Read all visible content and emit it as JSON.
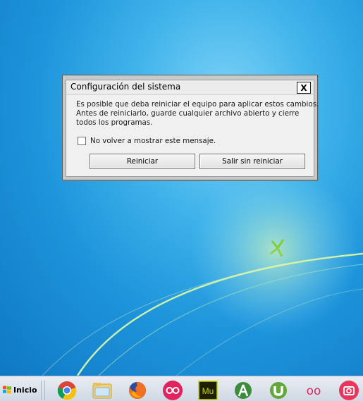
{
  "dialog": {
    "title": "Configuración del sistema",
    "close_glyph": "X",
    "message_lines": [
      "Es posible que deba reiniciar el equipo para aplicar estos cambios.",
      "Antes de reiniciarlo, guarde cualquier archivo abierto y cierre",
      "todos los programas."
    ],
    "checkbox_label": "No volver a mostrar este mensaje.",
    "checkbox_checked": false,
    "restart_button": "Reiniciar",
    "exit_button": "Salir sin reiniciar"
  },
  "taskbar": {
    "start_label": "Inicio",
    "apps": [
      {
        "icon": "chrome-icon"
      },
      {
        "icon": "file-explorer-icon"
      },
      {
        "icon": "firefox-icon"
      },
      {
        "icon": "flickr-icon"
      },
      {
        "icon": "adobe-muse-icon",
        "text": "Mu"
      },
      {
        "icon": "android-studio-icon"
      },
      {
        "icon": "utorrent-icon"
      },
      {
        "icon": "flickr-icon-2",
        "text": "oo"
      },
      {
        "icon": "camera-icon"
      }
    ]
  }
}
